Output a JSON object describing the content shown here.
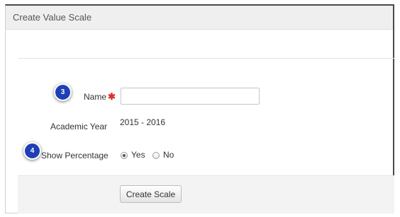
{
  "panel": {
    "title": "Create Value Scale"
  },
  "form": {
    "name": {
      "label": "Name",
      "required_marker": "✱",
      "value": ""
    },
    "academic_year": {
      "label": "Academic Year",
      "value": "2015 - 2016"
    },
    "show_percentage": {
      "label": "Show Percentage",
      "options": [
        {
          "label": "Yes",
          "checked": true
        },
        {
          "label": "No",
          "checked": false
        }
      ]
    },
    "submit_label": "Create Scale"
  },
  "annotations": [
    {
      "number": "3"
    },
    {
      "number": "4"
    }
  ],
  "colors": {
    "badge": "#1f3fb7",
    "required": "#d9302c"
  }
}
